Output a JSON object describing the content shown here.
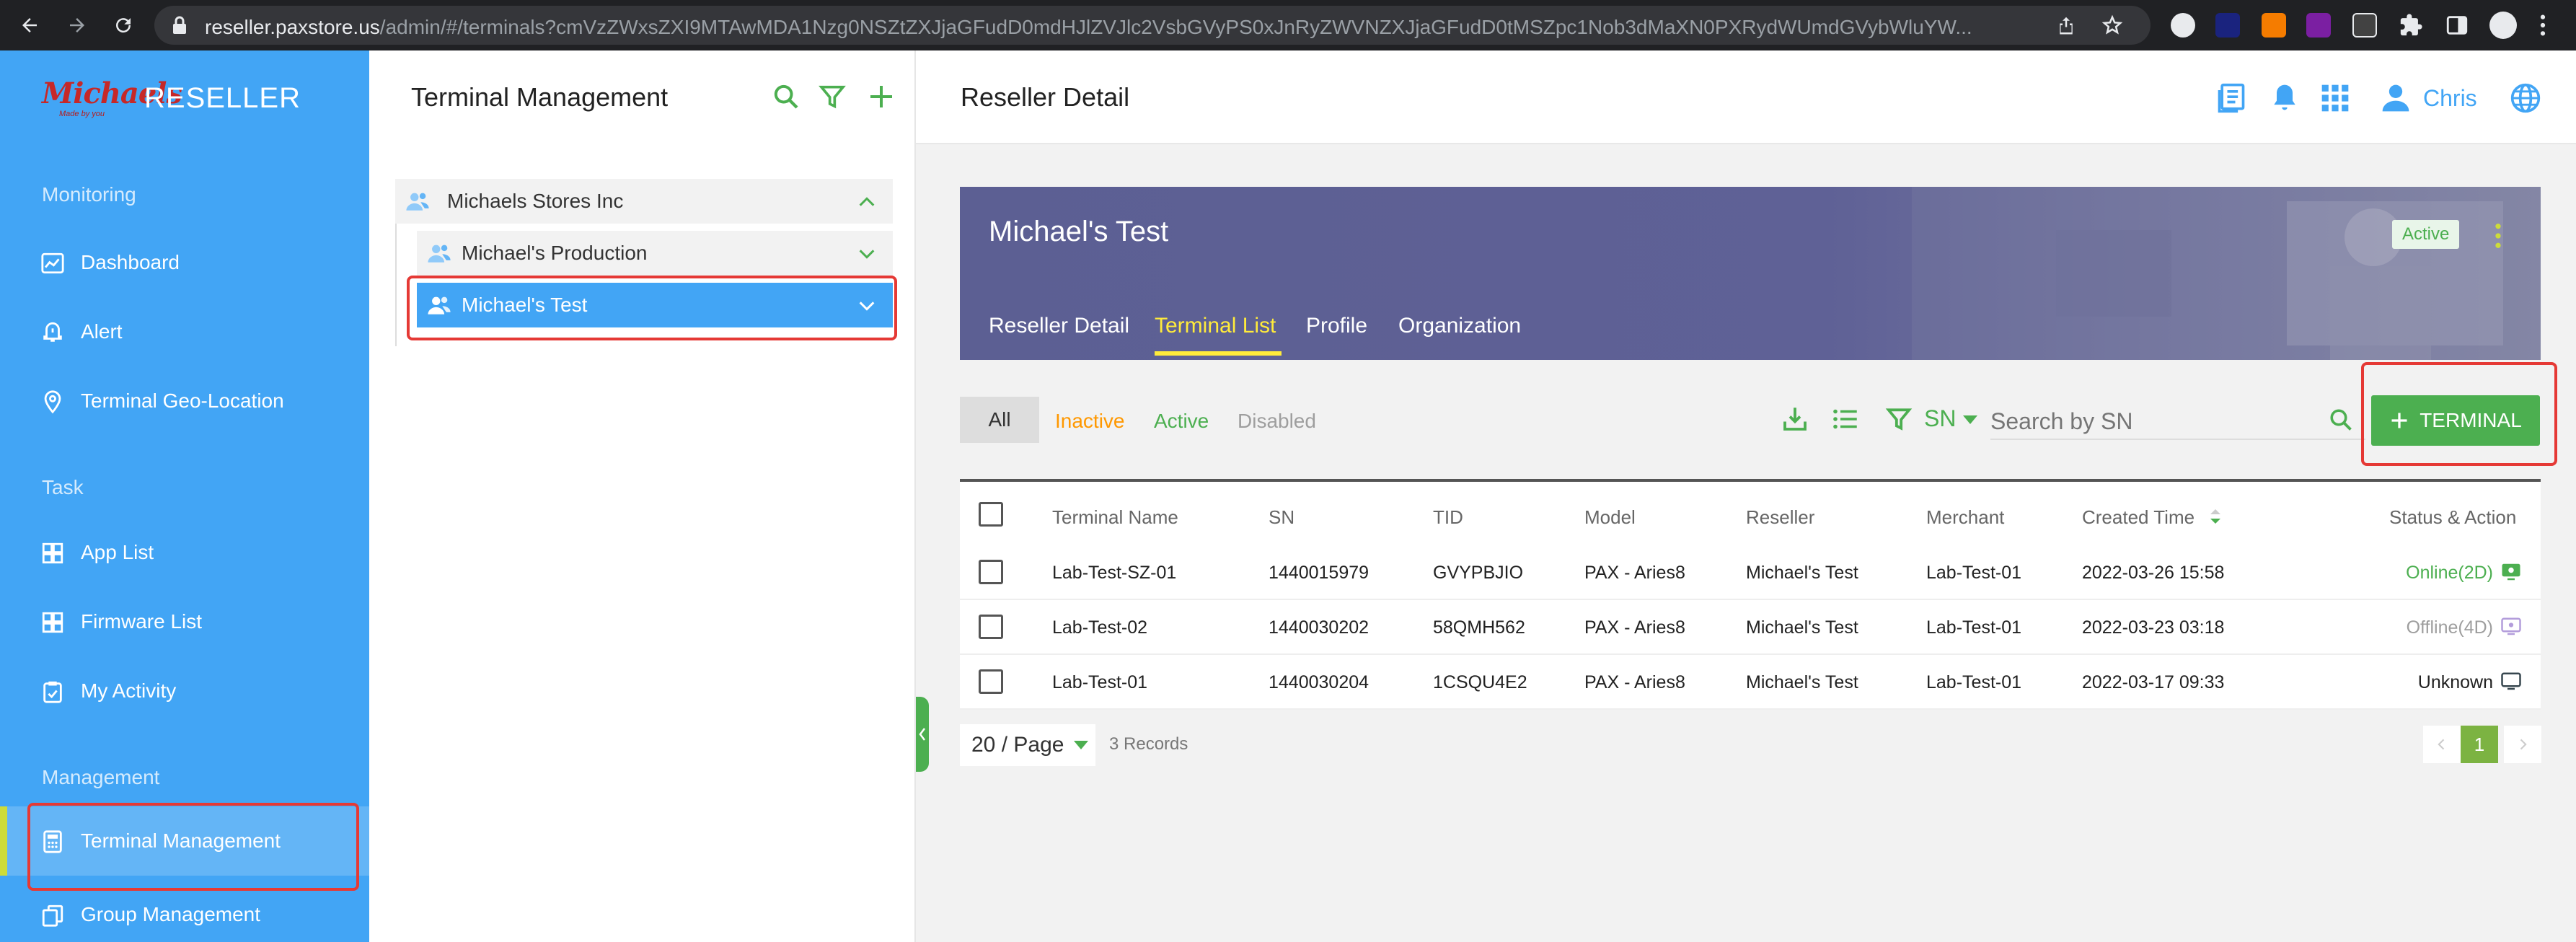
{
  "browser": {
    "url_host": "reseller.paxstore.us",
    "url_path": "/admin/#/terminals?cmVzZWxsZXI9MTAwMDA1Nzg0NSZtZXJjaGFudD0mdHJlZVJlc2VsbGVyPS0xJnRyZWVNZXJjaGFudD0tMSZpc1Nob3dMaXN0PXRydWUmdGVybWluYW..."
  },
  "sidebar": {
    "brand_logo": "Michaels",
    "brand_tagline": "Made by you",
    "brand_name": "RESELLER",
    "sections": [
      {
        "title": "Monitoring",
        "items": [
          {
            "label": "Dashboard",
            "icon": "dashboard-icon"
          },
          {
            "label": "Alert",
            "icon": "alert-icon"
          },
          {
            "label": "Terminal Geo-Location",
            "icon": "location-pin-icon"
          }
        ]
      },
      {
        "title": "Task",
        "items": [
          {
            "label": "App List",
            "icon": "grid-icon"
          },
          {
            "label": "Firmware List",
            "icon": "grid-icon"
          },
          {
            "label": "My Activity",
            "icon": "clipboard-icon"
          }
        ]
      },
      {
        "title": "Management",
        "items": [
          {
            "label": "Terminal Management",
            "icon": "calculator-icon",
            "active": true
          },
          {
            "label": "Group Management",
            "icon": "copy-icon"
          }
        ]
      }
    ]
  },
  "tree": {
    "title": "Terminal Management",
    "nodes": [
      {
        "label": "Michaels Stores Inc",
        "expanded": true
      },
      {
        "label": "Michael's Production",
        "expanded": false
      },
      {
        "label": "Michael's Test",
        "expanded": false,
        "selected": true
      }
    ]
  },
  "header": {
    "title": "Reseller Detail",
    "user": "Chris"
  },
  "reseller": {
    "name": "Michael's Test",
    "status": "Active",
    "tabs": [
      "Reseller Detail",
      "Terminal List",
      "Profile",
      "Organization"
    ],
    "active_tab": "Terminal List"
  },
  "filters": {
    "status_options": [
      "All",
      "Inactive",
      "Active",
      "Disabled"
    ],
    "search_field": "SN",
    "search_placeholder": "Search by SN",
    "add_button": "TERMINAL"
  },
  "table": {
    "columns": [
      "Terminal Name",
      "SN",
      "TID",
      "Model",
      "Reseller",
      "Merchant",
      "Created Time",
      "Status & Action"
    ],
    "rows": [
      {
        "name": "Lab-Test-SZ-01",
        "sn": "1440015979",
        "tid": "GVYPBJIO",
        "model": "PAX - Aries8",
        "reseller": "Michael's Test",
        "merchant": "Lab-Test-01",
        "created": "2022-03-26 15:58",
        "status": "Online(2D)",
        "status_color": "#4caf50"
      },
      {
        "name": "Lab-Test-02",
        "sn": "1440030202",
        "tid": "58QMH562",
        "model": "PAX - Aries8",
        "reseller": "Michael's Test",
        "merchant": "Lab-Test-01",
        "created": "2022-03-23 03:18",
        "status": "Offline(4D)",
        "status_color": "#9e9e9e"
      },
      {
        "name": "Lab-Test-01",
        "sn": "1440030204",
        "tid": "1CSQU4E2",
        "model": "PAX - Aries8",
        "reseller": "Michael's Test",
        "merchant": "Lab-Test-01",
        "created": "2022-03-17 09:33",
        "status": "Unknown",
        "status_color": "#222222"
      }
    ]
  },
  "pagination": {
    "page_size": "20 / Page",
    "records": "3 Records",
    "current_page": "1"
  },
  "colors": {
    "sidebar": "#42a5f5",
    "accent_green": "#4caf50",
    "banner": "#5c5f93",
    "highlight": "#e53935"
  }
}
